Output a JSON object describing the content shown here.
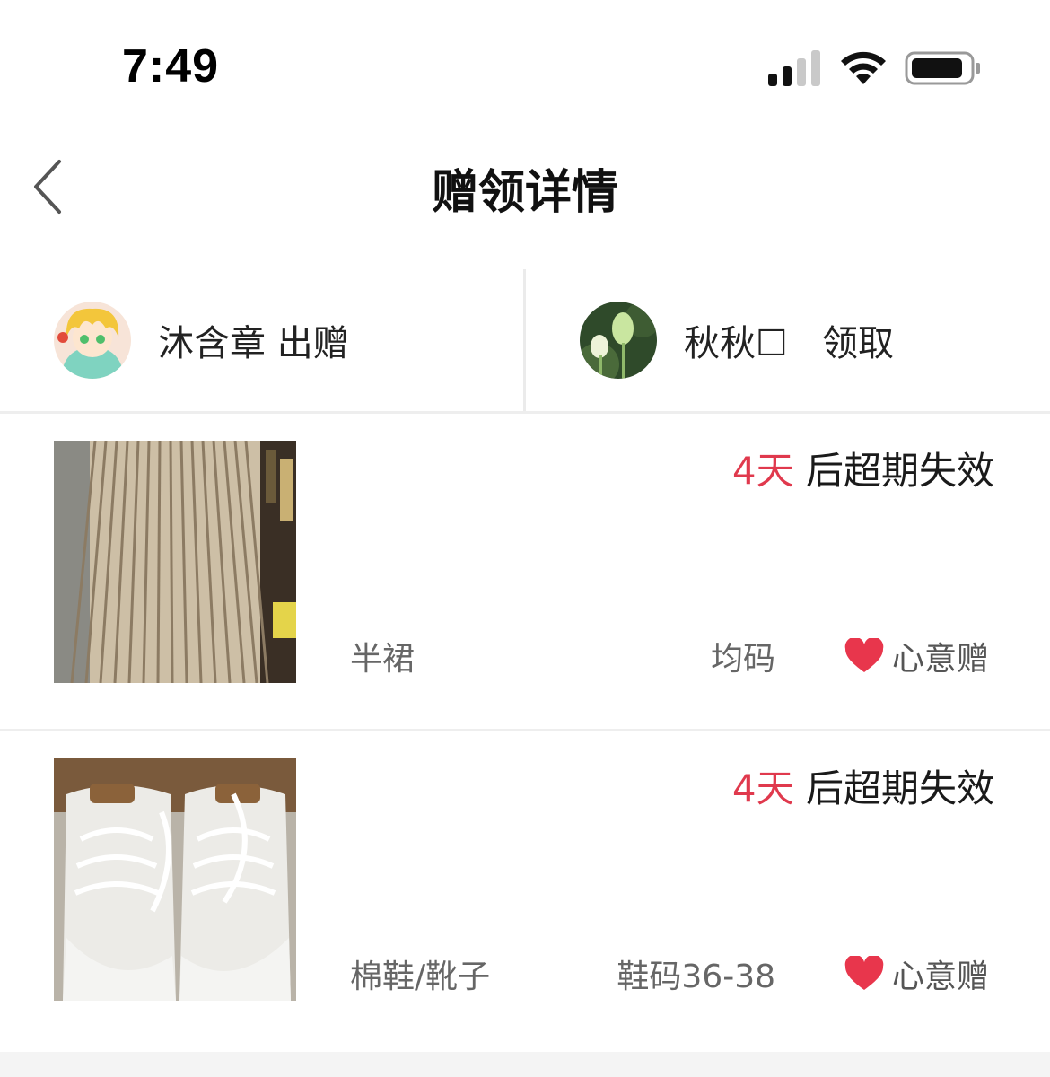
{
  "status": {
    "time": "7:49"
  },
  "nav": {
    "title": "赠领详情"
  },
  "parties": {
    "giver": {
      "name": "沐含章",
      "action": "出赠"
    },
    "receiver": {
      "name": "秋秋☐",
      "action": "领取"
    }
  },
  "items": [
    {
      "days": "4天",
      "expire_suffix": " 后超期失效",
      "category": "半裙",
      "size": "均码",
      "tag": "心意赠",
      "image": "pleated-skirt-photo"
    },
    {
      "days": "4天",
      "expire_suffix": " 后超期失效",
      "category": "棉鞋/靴子",
      "size": "鞋码36-38",
      "tag": "心意赠",
      "image": "white-sneakers-photo"
    }
  ],
  "colors": {
    "accent_red": "#e0394d",
    "heart": "#e8364c"
  }
}
